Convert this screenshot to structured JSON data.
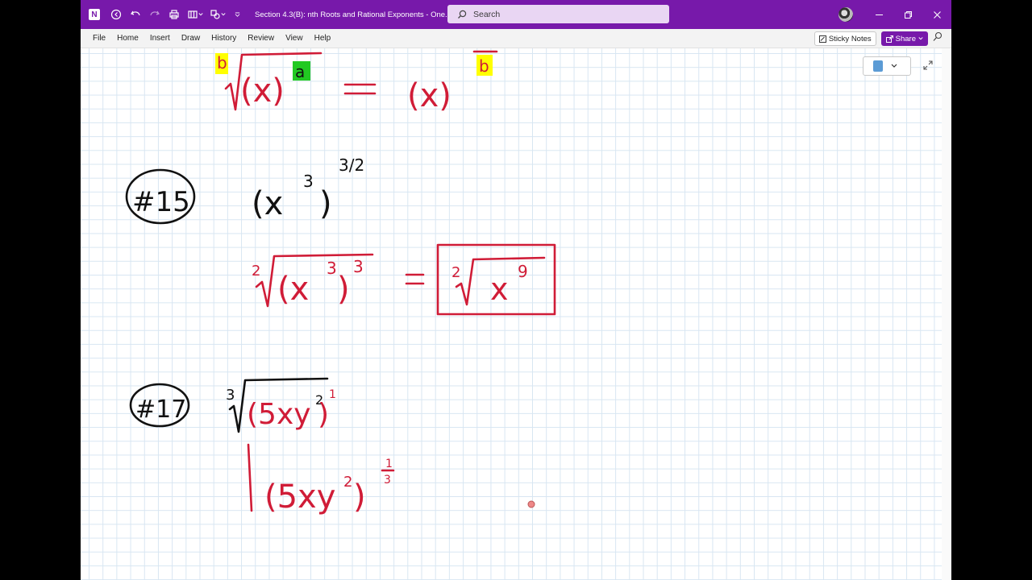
{
  "titlebar": {
    "doc_title": "Section 4.3(B): nth Roots and Rational Exponents  -  One...",
    "search_placeholder": "Search"
  },
  "menu": {
    "items": [
      "File",
      "Home",
      "Insert",
      "Draw",
      "History",
      "Review",
      "View",
      "Help"
    ],
    "sticky_notes": "Sticky Notes",
    "share": "Share"
  },
  "ink": {
    "rule": {
      "index": "b",
      "base": "(x)",
      "power": "a",
      "equals": "=",
      "rhs_base": "(x)",
      "rhs_den": "b"
    },
    "problem15": {
      "label": "#15",
      "expr_base": "(x",
      "expr_inner_exp": "3",
      "expr_close": ")",
      "expr_outer_exp": "3/2",
      "step_index": "2",
      "step_base": "(x",
      "step_inner_exp": "3",
      "step_close": ")",
      "step_outer_exp": "3",
      "equals": "=",
      "answer_index": "2",
      "answer_base": "x",
      "answer_exp": "9"
    },
    "problem17": {
      "label": "#17",
      "root_index": "3",
      "radicand": "(5xy",
      "radicand_exp": "2",
      "radicand_close": ")",
      "radicand_power": "1",
      "step_expr": "(5xy",
      "step_inner_exp": "2",
      "step_close": ")",
      "step_num": "1",
      "step_den": "3"
    }
  }
}
